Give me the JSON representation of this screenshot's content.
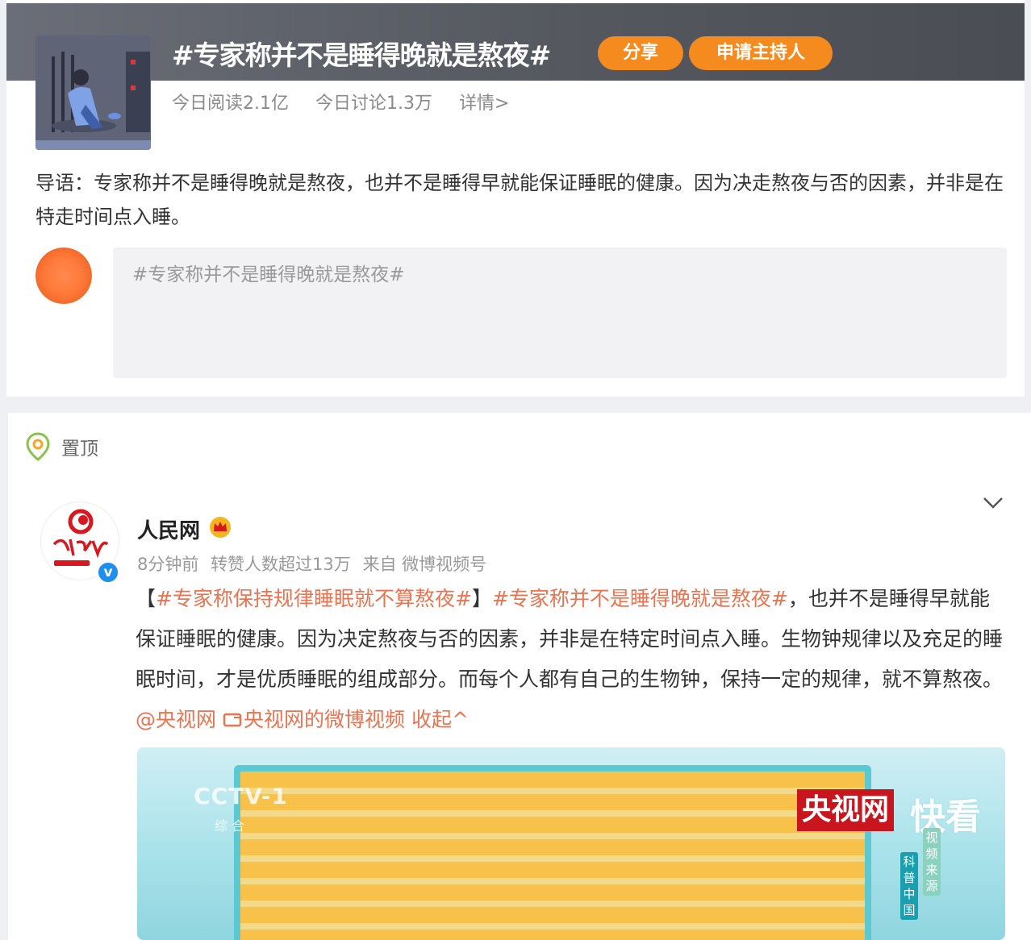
{
  "topic": {
    "title": "#专家称并不是睡得晚就是熬夜#",
    "share_label": "分享",
    "host_label": "申请主持人",
    "read_today": "今日阅读2.1亿",
    "discuss_today": "今日讨论1.3万",
    "details_label": "详情>",
    "intro": "导语：专家称并不是睡得晚就是熬夜，也并不是睡得早就能保证睡眠的健康。因为决走熬夜与否的因素，并非是在特走时间点入睡。",
    "comment_placeholder": "#专家称并不是睡得晚就是熬夜#"
  },
  "feed": {
    "pin_label": "置顶",
    "post": {
      "author": "人民网",
      "verified_mark": "v",
      "time": "8分钟前",
      "reposts": "转赞人数超过13万",
      "source": "来自 微博视频号",
      "bracket_open": "【",
      "tag1": "#专家称保持规律睡眠就不算熬夜#",
      "bracket_close": "】",
      "tag2": "#专家称并不是睡得晚就是熬夜#",
      "body": "，也并不是睡得早就能保证睡眠的健康。因为决定熬夜与否的因素，并非是在特定时间点入睡。生物钟规律以及充足的睡眠时间，才是优质睡眠的组成部分。而每个人都有自己的生物钟，保持一定的规律，就不算熬夜。",
      "mention": "@央视网",
      "video_link": "央视网的微博视频",
      "collapse_label": "收起^"
    },
    "video": {
      "channel": "CCTV-1",
      "channel_sub": "综 合",
      "brand": "央视网",
      "brand_fast": "快看",
      "side_label_1": "科普中国",
      "side_label_2": "视频来源"
    }
  },
  "colors": {
    "accent_orange": "#f58a1f",
    "link": "#eb7350",
    "verified_blue": "#1e8ef0",
    "cctv_red": "#c9151e"
  }
}
